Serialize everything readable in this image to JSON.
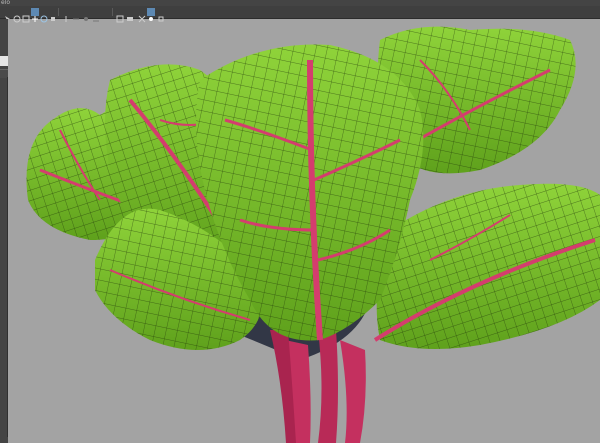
{
  "window": {
    "title": "elo"
  },
  "toolbar": {
    "icons": [
      "select-tool-icon",
      "lasso-tool-icon",
      "paint-tool-icon",
      "move-tool-icon",
      "rotate-tool-icon",
      "scale-tool-icon",
      "snap-grid-icon",
      "snap-curve-icon",
      "snap-point-icon",
      "snap-plane-icon",
      "render-view-icon",
      "camera-icon",
      "wireframe-icon",
      "ipr-render-icon"
    ]
  },
  "viewport": {
    "background": "#a3a3a3",
    "subject": "leaf-mesh"
  },
  "colors": {
    "leaf": "#7fc72a",
    "leaf_dark": "#3f6b12",
    "vein": "#d43d6e",
    "stem": "#c4305f",
    "wire": "#1d3208"
  }
}
